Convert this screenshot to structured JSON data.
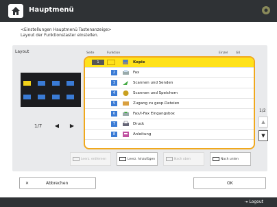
{
  "header": {
    "title": "Hauptmenü"
  },
  "instructions": {
    "line1": "<Einstellungen Hauptmenü Tastenanzeige>",
    "line2": "Layout der Funktionstaster einstellen."
  },
  "layout_label": "Layout",
  "pager_left": "1/7",
  "list": {
    "col_seite": "Seite",
    "col_funktion": "Funktion",
    "col_einzel": "Einzel",
    "col_gross": "Gß",
    "rows": [
      {
        "num": "1",
        "label": "Kopie",
        "selected": true
      },
      {
        "num": "2",
        "label": "Fax"
      },
      {
        "num": "3",
        "label": "Scannen und Senden"
      },
      {
        "num": "4",
        "label": "Scannen und Speichern"
      },
      {
        "num": "5",
        "label": "Zugang zu gesp.Dateien"
      },
      {
        "num": "6",
        "label": "Fax/I-Fax Eingangsbox"
      },
      {
        "num": "7",
        "label": "Druck"
      },
      {
        "num": "8",
        "label": "Anleitung"
      }
    ]
  },
  "page_indicator": "1/2",
  "buttons": {
    "leerz_entfernen": "Leerz. entfernen",
    "leerz_hinzufuegen": "Leerz. hinzufügen",
    "nach_oben": "Nach oben",
    "nach_unten": "Nach unten",
    "abbrechen": "Abbrechen",
    "ok": "OK",
    "logout": "Logout"
  },
  "colors": {
    "header": "#2f3235",
    "accent": "#f0a81c",
    "selected": "#ffe21a",
    "key_blue": "#3a7bd5"
  }
}
